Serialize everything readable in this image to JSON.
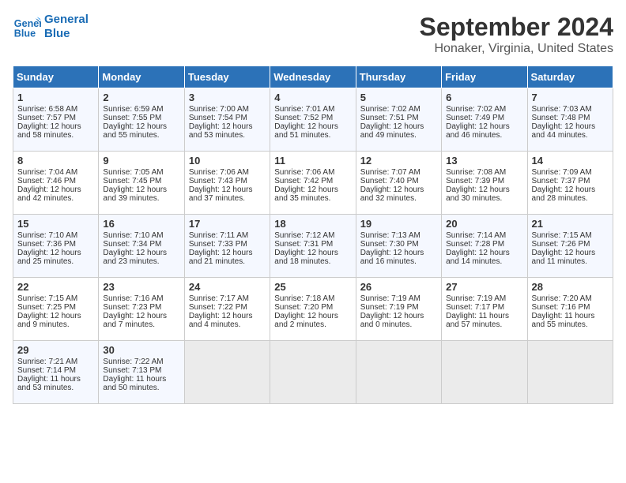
{
  "header": {
    "logo_line1": "General",
    "logo_line2": "Blue",
    "title": "September 2024",
    "subtitle": "Honaker, Virginia, United States"
  },
  "days_of_week": [
    "Sunday",
    "Monday",
    "Tuesday",
    "Wednesday",
    "Thursday",
    "Friday",
    "Saturday"
  ],
  "weeks": [
    [
      {
        "day": 1,
        "lines": [
          "Sunrise: 6:58 AM",
          "Sunset: 7:57 PM",
          "Daylight: 12 hours",
          "and 58 minutes."
        ]
      },
      {
        "day": 2,
        "lines": [
          "Sunrise: 6:59 AM",
          "Sunset: 7:55 PM",
          "Daylight: 12 hours",
          "and 55 minutes."
        ]
      },
      {
        "day": 3,
        "lines": [
          "Sunrise: 7:00 AM",
          "Sunset: 7:54 PM",
          "Daylight: 12 hours",
          "and 53 minutes."
        ]
      },
      {
        "day": 4,
        "lines": [
          "Sunrise: 7:01 AM",
          "Sunset: 7:52 PM",
          "Daylight: 12 hours",
          "and 51 minutes."
        ]
      },
      {
        "day": 5,
        "lines": [
          "Sunrise: 7:02 AM",
          "Sunset: 7:51 PM",
          "Daylight: 12 hours",
          "and 49 minutes."
        ]
      },
      {
        "day": 6,
        "lines": [
          "Sunrise: 7:02 AM",
          "Sunset: 7:49 PM",
          "Daylight: 12 hours",
          "and 46 minutes."
        ]
      },
      {
        "day": 7,
        "lines": [
          "Sunrise: 7:03 AM",
          "Sunset: 7:48 PM",
          "Daylight: 12 hours",
          "and 44 minutes."
        ]
      }
    ],
    [
      {
        "day": 8,
        "lines": [
          "Sunrise: 7:04 AM",
          "Sunset: 7:46 PM",
          "Daylight: 12 hours",
          "and 42 minutes."
        ]
      },
      {
        "day": 9,
        "lines": [
          "Sunrise: 7:05 AM",
          "Sunset: 7:45 PM",
          "Daylight: 12 hours",
          "and 39 minutes."
        ]
      },
      {
        "day": 10,
        "lines": [
          "Sunrise: 7:06 AM",
          "Sunset: 7:43 PM",
          "Daylight: 12 hours",
          "and 37 minutes."
        ]
      },
      {
        "day": 11,
        "lines": [
          "Sunrise: 7:06 AM",
          "Sunset: 7:42 PM",
          "Daylight: 12 hours",
          "and 35 minutes."
        ]
      },
      {
        "day": 12,
        "lines": [
          "Sunrise: 7:07 AM",
          "Sunset: 7:40 PM",
          "Daylight: 12 hours",
          "and 32 minutes."
        ]
      },
      {
        "day": 13,
        "lines": [
          "Sunrise: 7:08 AM",
          "Sunset: 7:39 PM",
          "Daylight: 12 hours",
          "and 30 minutes."
        ]
      },
      {
        "day": 14,
        "lines": [
          "Sunrise: 7:09 AM",
          "Sunset: 7:37 PM",
          "Daylight: 12 hours",
          "and 28 minutes."
        ]
      }
    ],
    [
      {
        "day": 15,
        "lines": [
          "Sunrise: 7:10 AM",
          "Sunset: 7:36 PM",
          "Daylight: 12 hours",
          "and 25 minutes."
        ]
      },
      {
        "day": 16,
        "lines": [
          "Sunrise: 7:10 AM",
          "Sunset: 7:34 PM",
          "Daylight: 12 hours",
          "and 23 minutes."
        ]
      },
      {
        "day": 17,
        "lines": [
          "Sunrise: 7:11 AM",
          "Sunset: 7:33 PM",
          "Daylight: 12 hours",
          "and 21 minutes."
        ]
      },
      {
        "day": 18,
        "lines": [
          "Sunrise: 7:12 AM",
          "Sunset: 7:31 PM",
          "Daylight: 12 hours",
          "and 18 minutes."
        ]
      },
      {
        "day": 19,
        "lines": [
          "Sunrise: 7:13 AM",
          "Sunset: 7:30 PM",
          "Daylight: 12 hours",
          "and 16 minutes."
        ]
      },
      {
        "day": 20,
        "lines": [
          "Sunrise: 7:14 AM",
          "Sunset: 7:28 PM",
          "Daylight: 12 hours",
          "and 14 minutes."
        ]
      },
      {
        "day": 21,
        "lines": [
          "Sunrise: 7:15 AM",
          "Sunset: 7:26 PM",
          "Daylight: 12 hours",
          "and 11 minutes."
        ]
      }
    ],
    [
      {
        "day": 22,
        "lines": [
          "Sunrise: 7:15 AM",
          "Sunset: 7:25 PM",
          "Daylight: 12 hours",
          "and 9 minutes."
        ]
      },
      {
        "day": 23,
        "lines": [
          "Sunrise: 7:16 AM",
          "Sunset: 7:23 PM",
          "Daylight: 12 hours",
          "and 7 minutes."
        ]
      },
      {
        "day": 24,
        "lines": [
          "Sunrise: 7:17 AM",
          "Sunset: 7:22 PM",
          "Daylight: 12 hours",
          "and 4 minutes."
        ]
      },
      {
        "day": 25,
        "lines": [
          "Sunrise: 7:18 AM",
          "Sunset: 7:20 PM",
          "Daylight: 12 hours",
          "and 2 minutes."
        ]
      },
      {
        "day": 26,
        "lines": [
          "Sunrise: 7:19 AM",
          "Sunset: 7:19 PM",
          "Daylight: 12 hours",
          "and 0 minutes."
        ]
      },
      {
        "day": 27,
        "lines": [
          "Sunrise: 7:19 AM",
          "Sunset: 7:17 PM",
          "Daylight: 11 hours",
          "and 57 minutes."
        ]
      },
      {
        "day": 28,
        "lines": [
          "Sunrise: 7:20 AM",
          "Sunset: 7:16 PM",
          "Daylight: 11 hours",
          "and 55 minutes."
        ]
      }
    ],
    [
      {
        "day": 29,
        "lines": [
          "Sunrise: 7:21 AM",
          "Sunset: 7:14 PM",
          "Daylight: 11 hours",
          "and 53 minutes."
        ]
      },
      {
        "day": 30,
        "lines": [
          "Sunrise: 7:22 AM",
          "Sunset: 7:13 PM",
          "Daylight: 11 hours",
          "and 50 minutes."
        ]
      },
      null,
      null,
      null,
      null,
      null
    ]
  ]
}
